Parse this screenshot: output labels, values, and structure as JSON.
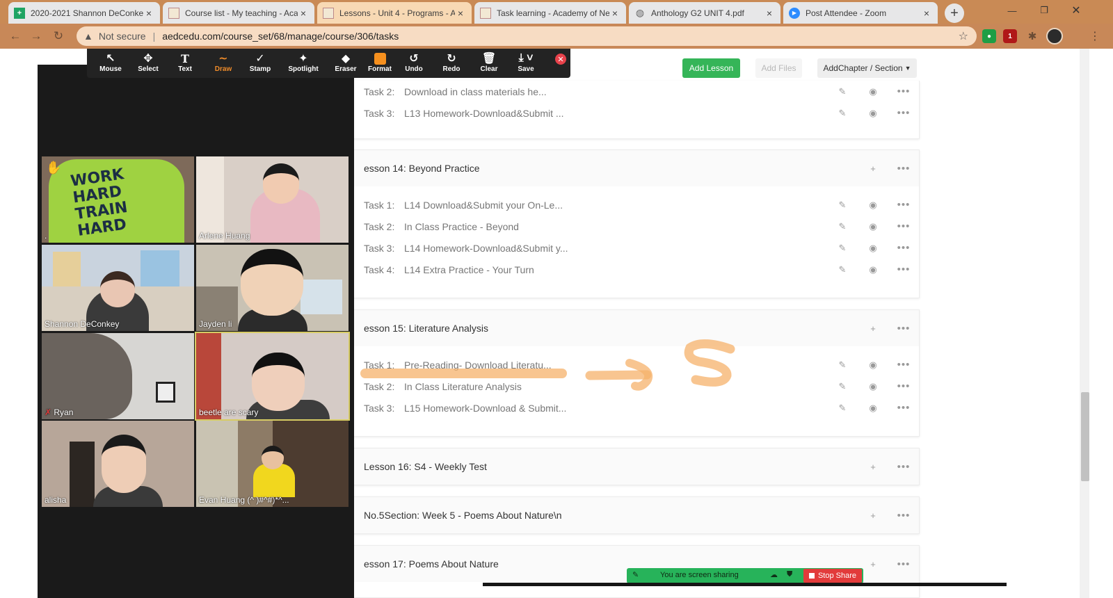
{
  "browser": {
    "tabs": [
      {
        "title": "2020-2021 Shannon DeConkey",
        "icon": "sheets-icon"
      },
      {
        "title": "Course list - My teaching - Aca",
        "icon": "site-icon"
      },
      {
        "title": "Lessons - Unit 4 - Programs - A",
        "icon": "site-icon"
      },
      {
        "title": "Task learning - Academy of Ne",
        "icon": "site-icon"
      },
      {
        "title": "Anthology G2 UNIT 4.pdf",
        "icon": "globe-icon"
      },
      {
        "title": "Post Attendee - Zoom",
        "icon": "zoom-icon"
      }
    ],
    "address": {
      "security": "Not secure",
      "url": "aedcedu.com/course_set/68/manage/course/306/tasks"
    },
    "extension_badge": "1"
  },
  "zoom_toolbar": {
    "tools": [
      "Mouse",
      "Select",
      "Text",
      "Draw",
      "Stamp",
      "Spotlight",
      "Eraser",
      "Format",
      "Undo",
      "Redo",
      "Clear",
      "Save"
    ],
    "active": "Draw",
    "format_color": "#f6901e"
  },
  "page": {
    "buttons": {
      "add_lesson": "Add Lesson",
      "add_files": "Add Files",
      "add_chapter": "AddChapter / Section"
    },
    "blocks": [
      {
        "tasks": [
          {
            "label": "Task 2:",
            "title": "Download in class materials he..."
          },
          {
            "label": "Task 3:",
            "title": "L13 Homework-Download&Submit ..."
          }
        ]
      },
      {
        "head": "esson 14:  Beyond Practice",
        "tasks": [
          {
            "label": "Task 1:",
            "title": "L14 Download&Submit your On-Le..."
          },
          {
            "label": "Task 2:",
            "title": "In Class Practice - Beyond"
          },
          {
            "label": "Task 3:",
            "title": "L14 Homework-Download&Submit y..."
          },
          {
            "label": "Task 4:",
            "title": "L14 Extra Practice - Your Turn"
          }
        ]
      },
      {
        "head": "esson 15:  Literature Analysis",
        "tasks": [
          {
            "label": "Task 1:",
            "title": "Pre-Reading- Download Literatu..."
          },
          {
            "label": "Task 2:",
            "title": "In Class Literature Analysis"
          },
          {
            "label": "Task 3:",
            "title": "L15 Homework-Download & Submit..."
          }
        ]
      },
      {
        "head": "Lesson 16:  S4 - Weekly Test"
      },
      {
        "head": "No.5Section:  Week 5 - Poems About Nature\\n"
      },
      {
        "head": "esson 17:  Poems About Nature"
      }
    ]
  },
  "gallery": {
    "participants": [
      {
        "name": ".",
        "hand_raised": true
      },
      {
        "name": "Arlene Huang"
      },
      {
        "name": "Shannon DeConkey"
      },
      {
        "name": "Jayden li"
      },
      {
        "name": "Ryan",
        "muted": true
      },
      {
        "name": "beetle are scary",
        "active_speaker": true
      },
      {
        "name": "alisha"
      },
      {
        "name": "Evan Huang (^ )#^#)*^..."
      }
    ],
    "shirt_text": "WORK HARD TRAIN HARD"
  },
  "share": {
    "status": "You are screen sharing",
    "stop": "Stop Share"
  },
  "annotation": {
    "color": "#f6b26b",
    "drawn_text": "S"
  }
}
